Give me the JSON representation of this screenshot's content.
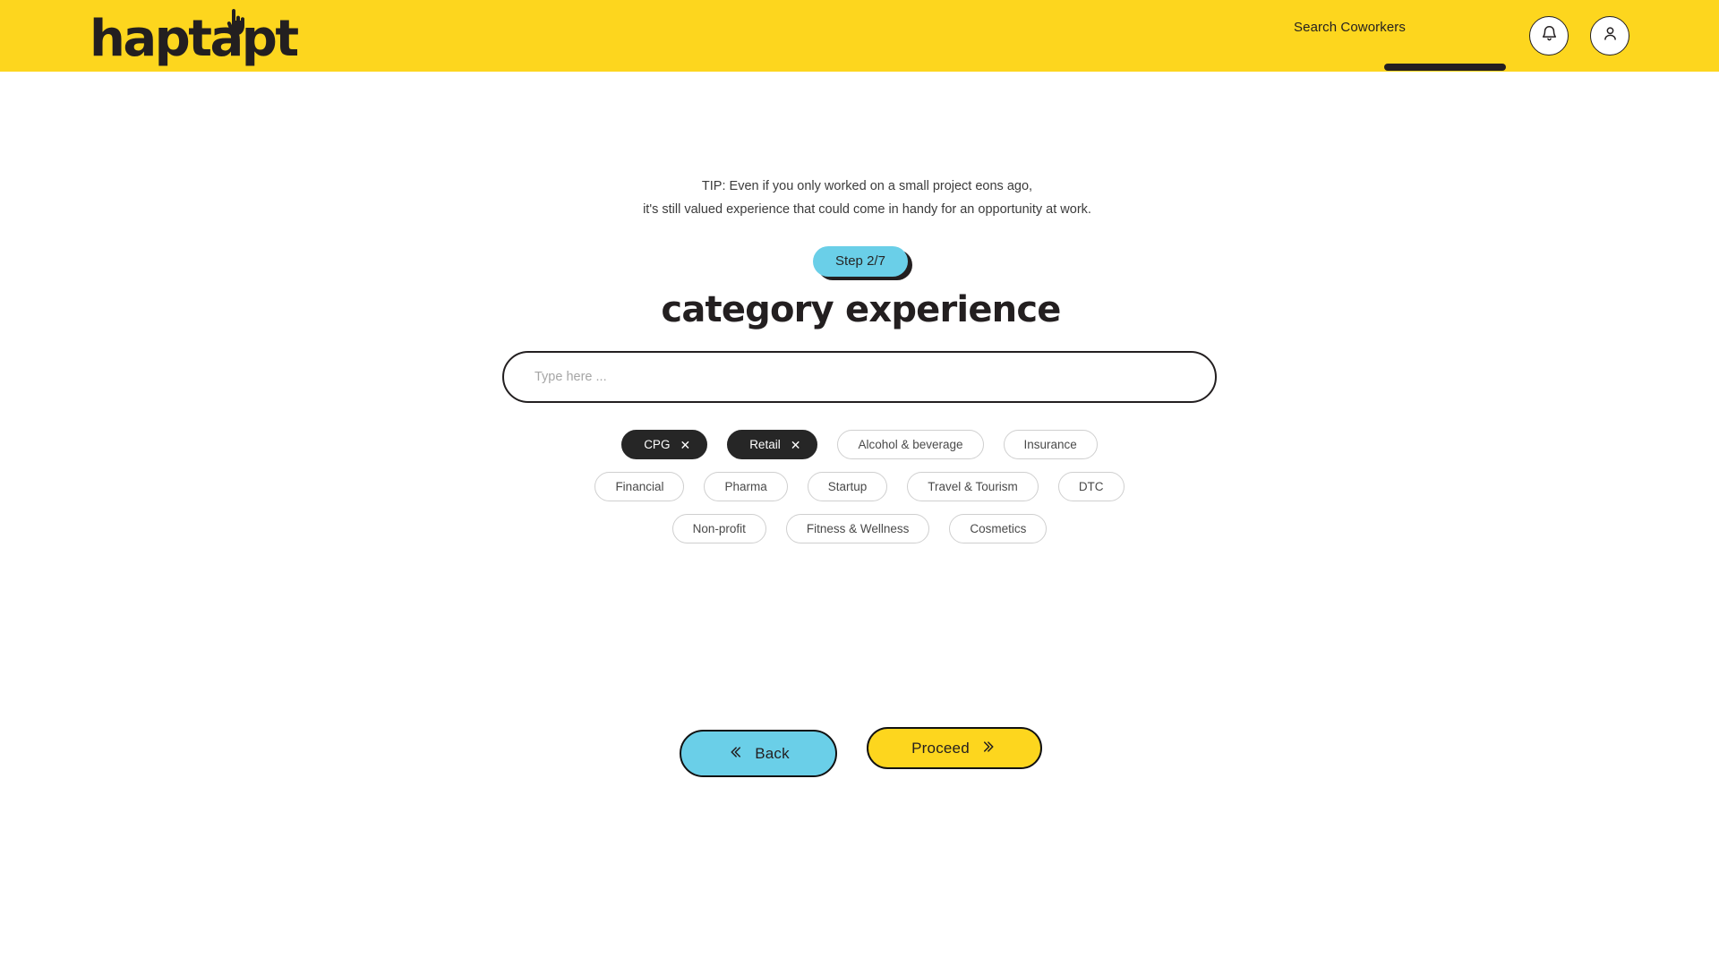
{
  "header": {
    "logo_text": "haptapt",
    "logo_icon": "pointing-hand-icon",
    "search_coworkers_label": "Search Coworkers",
    "notification_icon": "bell-icon",
    "account_icon": "user-avatar-icon",
    "background_color": "#FDD61E"
  },
  "main": {
    "tip_line_1": "TIP: Even if you only worked on a small project eons ago,",
    "tip_line_2": "it's still valued experience that could come in handy for an opportunity at work.",
    "step_badge": "Step 2/7",
    "step_badge_color": "#6ACFE8",
    "title": "category experience",
    "search": {
      "placeholder": "Type here ...",
      "value": ""
    },
    "chips": {
      "rows": [
        [
          {
            "label": "CPG",
            "selected": true,
            "close_icon": "close-x-icon"
          },
          {
            "label": "Retail",
            "selected": true,
            "close_icon": "close-x-icon"
          },
          {
            "label": "Alcohol & beverage",
            "selected": false
          },
          {
            "label": "Insurance",
            "selected": false
          }
        ],
        [
          {
            "label": "Financial",
            "selected": false
          },
          {
            "label": "Pharma",
            "selected": false
          },
          {
            "label": "Startup",
            "selected": false
          },
          {
            "label": "Travel & Tourism",
            "selected": false
          },
          {
            "label": "DTC",
            "selected": false
          }
        ],
        [
          {
            "label": "Non-profit",
            "selected": false
          },
          {
            "label": "Fitness & Wellness",
            "selected": false
          },
          {
            "label": "Cosmetics",
            "selected": false
          }
        ]
      ],
      "selected_color": "#262626"
    }
  },
  "footer": {
    "back_label": "Back",
    "back_icon": "chevron-double-left-icon",
    "back_color": "#6ACFE8",
    "proceed_label": "Proceed",
    "proceed_icon": "chevron-double-right-icon",
    "proceed_color": "#FDD61E"
  }
}
